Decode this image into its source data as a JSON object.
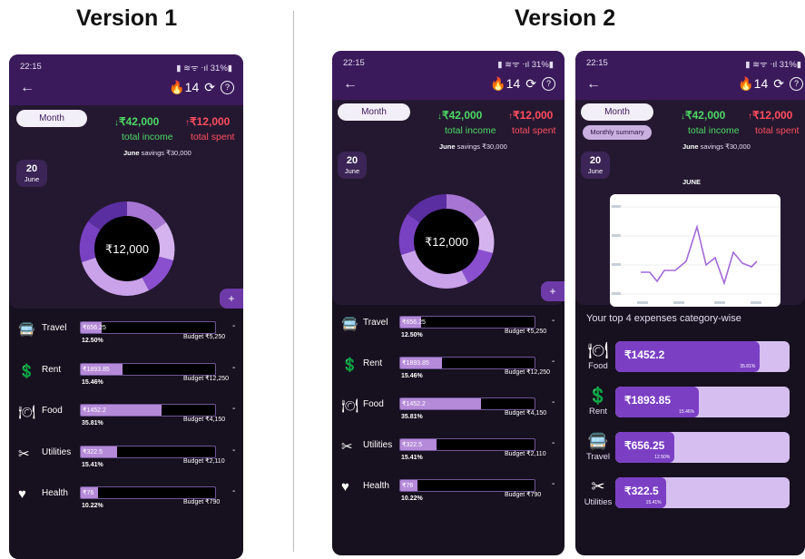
{
  "headings": {
    "v1": "Version 1",
    "v2": "Version 2"
  },
  "status": {
    "time": "22:15",
    "right": "▮ ≋ᯤ ⋅ıl 31%▮"
  },
  "toolbar": {
    "back": "←",
    "streak": "🔥14",
    "refresh": "⟳",
    "help": "?"
  },
  "summary": {
    "period_label": "Month",
    "income": "₹42,000",
    "income_label": "total income",
    "spent": "₹12,000",
    "spent_label": "total spent",
    "savings_month": "June",
    "savings_text": " savings ₹30,000",
    "date_day": "20",
    "date_month": "June",
    "donut_center": "₹12,000",
    "plus": "+",
    "monthly_summary": "Monthly summary",
    "chart_title": "JUNE"
  },
  "categories": [
    {
      "name": "Travel",
      "icon": "🚍",
      "amount": "₹656.25",
      "percent": "12.50%",
      "budget": "Budget ₹5,250",
      "fill": 0.155
    },
    {
      "name": "Rent",
      "icon": "💲",
      "amount": "₹1893.85",
      "percent": "15.46%",
      "budget": "Budget ₹12,250",
      "fill": 0.31
    },
    {
      "name": "Food",
      "icon": "🍽",
      "amount": "₹1452.2",
      "percent": "35.81%",
      "budget": "Budget ₹4,150",
      "fill": 0.6
    },
    {
      "name": "Utilities",
      "icon": "✂",
      "amount": "₹322.5",
      "percent": "15.41%",
      "budget": "Budget ₹2,110",
      "fill": 0.27
    },
    {
      "name": "Health",
      "icon": "♥",
      "amount": "₹76",
      "percent": "10.22%",
      "budget": "Budget ₹790",
      "fill": 0.13
    }
  ],
  "dash": "-",
  "top_expenses_title": "Your top 4 expenses category-wise",
  "top_expenses": [
    {
      "name": "Food",
      "icon": "🍽",
      "amount": "₹1452.2",
      "percent": "35.81%",
      "fill": 0.83
    },
    {
      "name": "Rent",
      "icon": "💲",
      "amount": "₹1893.85",
      "percent": "15.46%",
      "fill": 0.48
    },
    {
      "name": "Travel",
      "icon": "🚍",
      "amount": "₹656.25",
      "percent": "12.50%",
      "fill": 0.34
    },
    {
      "name": "Utilities",
      "icon": "✂",
      "amount": "₹322.5",
      "percent": "15.41%",
      "fill": 0.29
    }
  ],
  "colors": {
    "accent": "#7b3fc4",
    "income": "#4cd964",
    "spent": "#ff4d5e",
    "bg": "#17101f",
    "header": "#3b1a5c"
  }
}
